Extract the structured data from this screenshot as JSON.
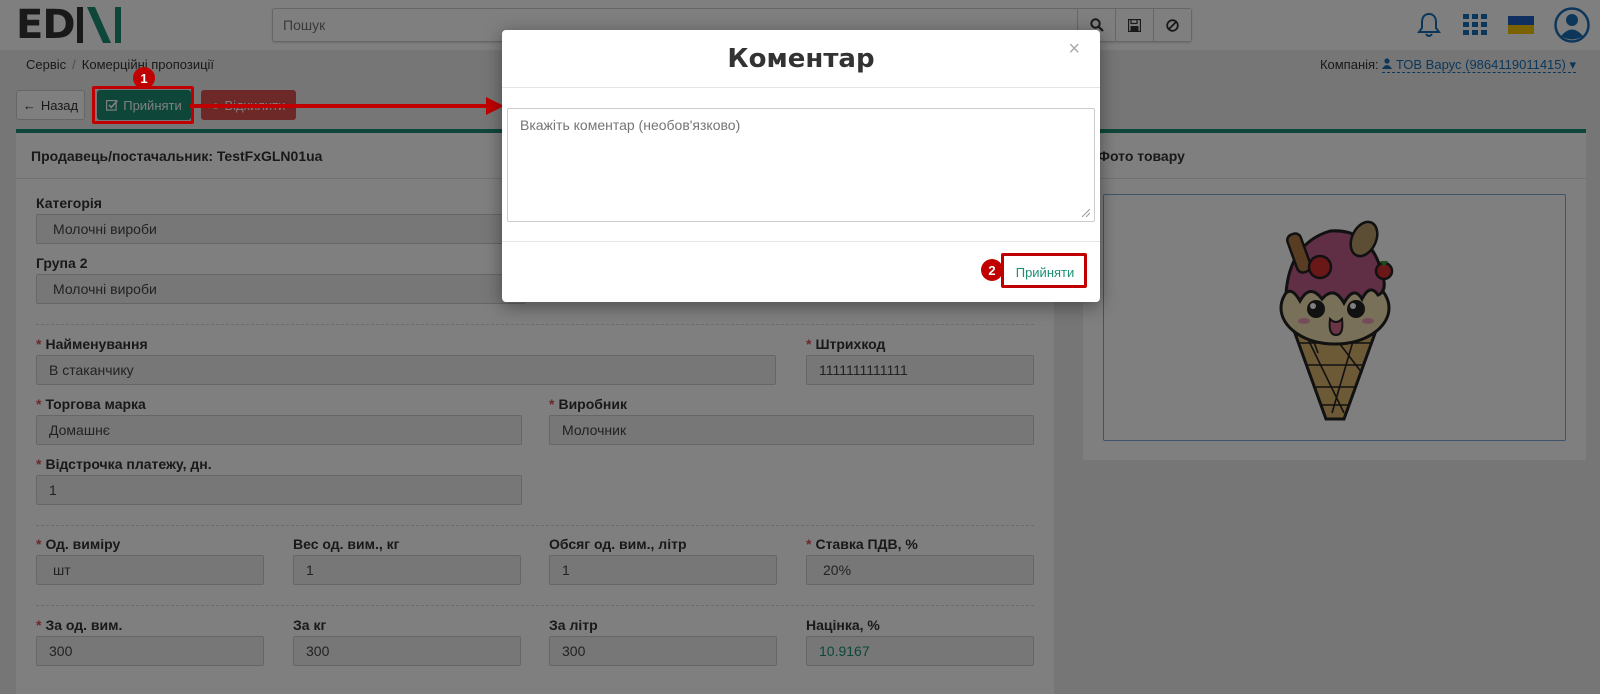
{
  "header": {
    "logo_text": "EDIN",
    "search_placeholder": "Пошук",
    "icons": [
      "search-icon",
      "save-icon",
      "clear-icon",
      "bell-icon",
      "apps-grid-icon",
      "ukraine-flag-icon",
      "user-avatar-icon"
    ]
  },
  "breadcrumb": {
    "items": [
      "Сервіс",
      "Комерційні пропозиції"
    ]
  },
  "company": {
    "label": "Компанія:",
    "value": "ТОВ Варус (9864119011415)"
  },
  "toolbar": {
    "back_label": "Назад",
    "accept_label": "Прийняти",
    "decline_label": "Відхилити"
  },
  "annotations": {
    "badge_1": "1",
    "badge_2": "2"
  },
  "panel_left": {
    "title": "Продавець/постачальник: TestFxGLN01ua",
    "fields": {
      "category_label": "Категорія",
      "category_value": "Молочні вироби",
      "group2_label": "Група 2",
      "group2_value": "Молочні вироби",
      "name_label": "Найменування",
      "name_value": "В стаканчику",
      "barcode_label": "Штрихкод",
      "barcode_value": "1111111111111",
      "brand_label": "Торгова марка",
      "brand_value": "Домашнє",
      "producer_label": "Виробник",
      "producer_value": "Молочник",
      "deferral_label": "Відстрочка платежу, дн.",
      "deferral_value": "1",
      "unit_label": "Од. виміру",
      "unit_value": "шт",
      "weight_label": "Вес од. вим., кг",
      "weight_value": "1",
      "volume_label": "Обсяг од. вим., літр",
      "volume_value": "1",
      "vat_label": "Ставка ПДВ, %",
      "vat_value": "20%",
      "per_unit_label": "За од. вим.",
      "per_unit_value": "300",
      "per_kg_label": "За кг",
      "per_kg_value": "300",
      "per_litre_label": "За літр",
      "per_litre_value": "300",
      "markup_label": "Націнка, %",
      "markup_value": "10.9167"
    }
  },
  "panel_right": {
    "title": "Фото товару"
  },
  "modal": {
    "title": "Коментар",
    "close_glyph": "×",
    "textarea_placeholder": "Вкажіть коментар (необов'язково)",
    "accept_label": "Прийняти"
  },
  "colors": {
    "brand_green": "#1d8f74",
    "danger_red": "#d9534f",
    "annotation_red": "#c00000",
    "link_blue": "#1a6fb5"
  }
}
